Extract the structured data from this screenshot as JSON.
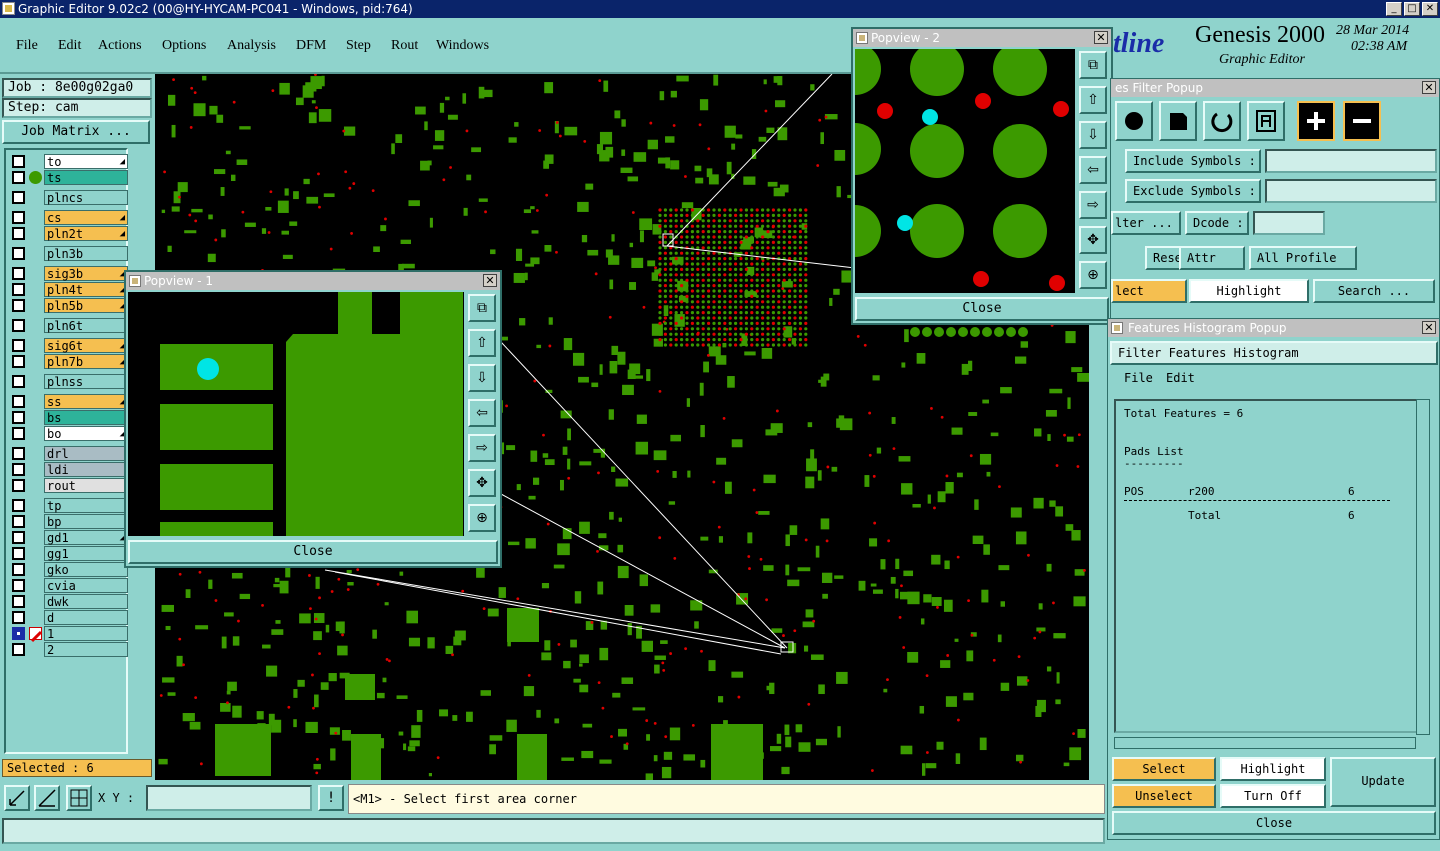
{
  "window": {
    "title": "Graphic Editor 9.02c2 (00@HY-HYCAM-PC041 - Windows, pid:764)"
  },
  "menu": [
    "File",
    "Edit",
    "Actions",
    "Options",
    "Analysis",
    "DFM",
    "Step",
    "Rout",
    "Windows"
  ],
  "job": {
    "job_label": "Job : 8e00g02ga0",
    "step_label": "Step: cam",
    "matrix_button": "Job Matrix ..."
  },
  "layers": [
    {
      "name": "to",
      "color": "#ffffff",
      "arrow": true
    },
    {
      "name": "ts",
      "color": "#2eb39a",
      "arrow": false
    },
    {
      "name": "plncs",
      "color": "#8fd3cc",
      "arrow": false
    },
    {
      "name": "cs",
      "color": "#f5bf50",
      "arrow": true
    },
    {
      "name": "pln2t",
      "color": "#f5bf50",
      "arrow": true
    },
    {
      "name": "pln3b",
      "color": "#8fd3cc",
      "arrow": false
    },
    {
      "name": "sig3b",
      "color": "#f5bf50",
      "arrow": true
    },
    {
      "name": "pln4t",
      "color": "#f5bf50",
      "arrow": true
    },
    {
      "name": "pln5b",
      "color": "#f5bf50",
      "arrow": true
    },
    {
      "name": "pln6t",
      "color": "#8fd3cc",
      "arrow": false
    },
    {
      "name": "sig6t",
      "color": "#f5bf50",
      "arrow": true
    },
    {
      "name": "pln7b",
      "color": "#f5bf50",
      "arrow": true
    },
    {
      "name": "plnss",
      "color": "#8fd3cc",
      "arrow": false
    },
    {
      "name": "ss",
      "color": "#f5bf50",
      "arrow": true
    },
    {
      "name": "bs",
      "color": "#2eb39a",
      "arrow": false
    },
    {
      "name": "bo",
      "color": "#ffffff",
      "arrow": true
    },
    {
      "name": "drl",
      "color": "#a9bcc4",
      "arrow": false
    },
    {
      "name": "ldi",
      "color": "#a9bcc4",
      "arrow": false
    },
    {
      "name": "rout",
      "color": "#e0e0e0",
      "arrow": false
    },
    {
      "name": "tp",
      "color": "#8fd3cc",
      "arrow": false
    },
    {
      "name": "bp",
      "color": "#8fd3cc",
      "arrow": false
    },
    {
      "name": "gd1",
      "color": "#8fd3cc",
      "arrow": true
    },
    {
      "name": "gg1",
      "color": "#8fd3cc",
      "arrow": false
    },
    {
      "name": "gko",
      "color": "#8fd3cc",
      "arrow": false
    },
    {
      "name": "cvia",
      "color": "#8fd3cc",
      "arrow": false
    },
    {
      "name": "dwk",
      "color": "#8fd3cc",
      "arrow": false
    },
    {
      "name": "d",
      "color": "#8fd3cc",
      "arrow": false
    },
    {
      "name": "1",
      "color": "#8fd3cc",
      "arrow": false
    },
    {
      "name": "2",
      "color": "#8fd3cc",
      "arrow": false
    }
  ],
  "selected_label": "Selected : 6",
  "xy_label": "X Y :",
  "xy_value": "",
  "message": "<M1> - Select first area corner",
  "popview1": {
    "title": "Popview - 1",
    "close": "Close"
  },
  "popview2": {
    "title": "Popview - 2",
    "close": "Close"
  },
  "brand": {
    "partial": "tline",
    "product": "Genesis 2000",
    "subtitle": "Graphic Editor",
    "date": "28 Mar 2014",
    "time": "02:38 AM"
  },
  "filter": {
    "title": "es Filter Popup",
    "include_symbols": "Include Symbols :",
    "exclude_symbols": "Exclude Symbols :",
    "filter_btn": "lter ...",
    "dcode": "Dcode :",
    "reset": "Reset",
    "attr": "Attr ...",
    "profile": "All Profile",
    "select": "lect",
    "highlight": "Highlight",
    "search": "Search ..."
  },
  "histogram": {
    "title": "Features Histogram Popup",
    "subtitle": "Filter Features Histogram",
    "menu": [
      "File",
      "Edit"
    ],
    "total": "Total Features = 6",
    "pads_list": "Pads List",
    "sep1": "---------",
    "row_type": "POS",
    "row_sym": "r200",
    "row_cnt": "6",
    "total_label": "Total",
    "total_cnt": "6",
    "select": "Select",
    "highlight": "Highlight",
    "update": "Update",
    "unselect": "Unselect",
    "turnoff": "Turn Off",
    "close": "Close"
  },
  "colors": {
    "panel": "#8fd3cc",
    "accent": "#f5bf50",
    "copper": "#3c9a00",
    "selected": "#00e5e5",
    "drill": "#e00000"
  }
}
